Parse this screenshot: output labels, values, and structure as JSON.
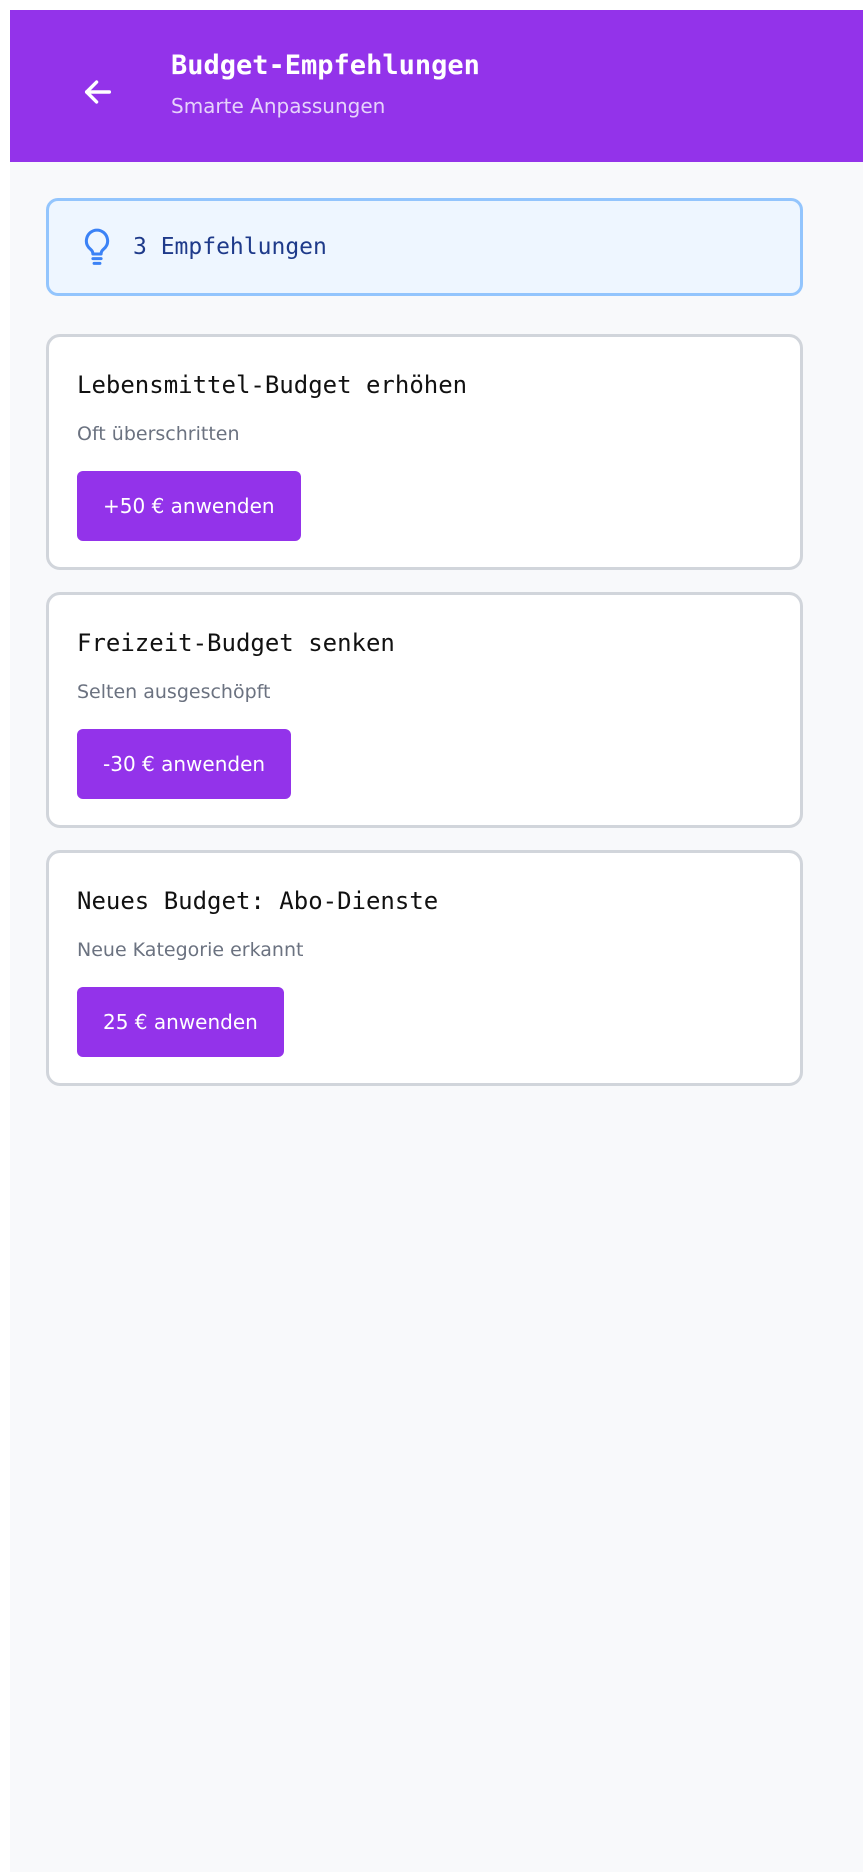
{
  "header": {
    "title": "Budget-Empfehlungen",
    "subtitle": "Smarte Anpassungen",
    "back_icon": "arrow-left-icon"
  },
  "info": {
    "icon": "lightbulb-icon",
    "text": "3 Empfehlungen"
  },
  "recommendations": [
    {
      "title": "Lebensmittel-Budget erhöhen",
      "description": "Oft überschritten",
      "button_label": "+50 € anwenden"
    },
    {
      "title": "Freizeit-Budget senken",
      "description": "Selten ausgeschöpft",
      "button_label": "-30 € anwenden"
    },
    {
      "title": "Neues Budget: Abo-Dienste",
      "description": "Neue Kategorie erkannt",
      "button_label": "25 € anwenden"
    }
  ],
  "colors": {
    "primary": "#9333ea",
    "info_bg": "#eef6ff",
    "info_border": "#93c5fd",
    "info_text": "#1e3a8a"
  }
}
